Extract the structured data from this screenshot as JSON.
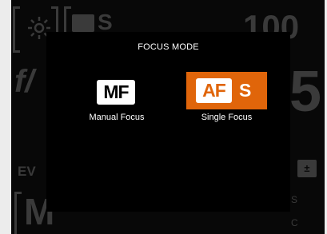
{
  "background": {
    "iso_value": "100",
    "aperture_label": "f/",
    "aperture_value": "5",
    "ev_label": "EV",
    "meter_mode": "M",
    "side_s": "S",
    "side_c": "C"
  },
  "dialog": {
    "title": "FOCUS MODE",
    "options": [
      {
        "icon_text": "MF",
        "label": "Manual Focus",
        "selected": false
      },
      {
        "icon_text": "AF",
        "icon_suffix": "S",
        "label": "Single Focus",
        "selected": true
      }
    ]
  },
  "colors": {
    "accent": "#e0650a",
    "panel": "#000000",
    "dim": "#3a3a3a",
    "frame": "#ececec"
  },
  "icons": [
    "sun-icon",
    "af-s-mini-icon",
    "exposure-compensation-icon"
  ]
}
